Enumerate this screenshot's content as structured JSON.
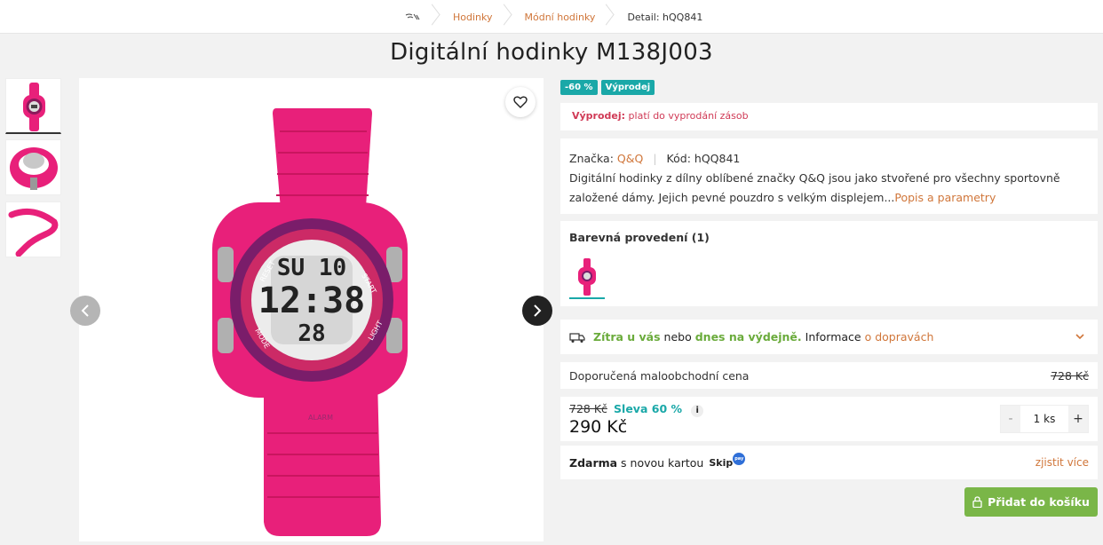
{
  "breadcrumb": {
    "items": [
      "Hodinky",
      "Módní hodinky",
      "Detail: hQQ841"
    ]
  },
  "product": {
    "title": "Digitální hodinky M138J003",
    "badges": [
      "-60 %",
      "Výprodej"
    ],
    "sale_label": "Výprodej:",
    "sale_text": "platí do vyprodání zásob",
    "brand_label": "Značka:",
    "brand": "Q&Q",
    "code_label": "Kód:",
    "code": "hQQ841",
    "description": "Digitální hodinky z dílny oblíbené značky Q&Q jsou jako stvořené pro všechny sportovně založené dámy. Jejich pevné pouzdro s velkým displejem...",
    "description_link": "Popis a parametry",
    "variants_title": "Barevná provedení (1)"
  },
  "delivery": {
    "part1": "Zítra u vás",
    "part2": " nebo ",
    "part3": "dnes na výdejně.",
    "part4": " Informace ",
    "link": "o dopravách"
  },
  "pricing": {
    "rrp_label": "Doporučená maloobchodní cena",
    "rrp_value": "728 Kč",
    "old_price": "728 Kč",
    "discount": "Sleva 60 %",
    "info_icon": "i",
    "price": "290 Kč",
    "qty_minus": "-",
    "qty_value": "1 ks",
    "qty_plus": "+"
  },
  "promo": {
    "bold": "Zdarma",
    "text": " s novou kartou",
    "brand": "Skip",
    "brand_badge": "pay",
    "link": "zjistit více"
  },
  "add_to_cart": "Přidat do košíku",
  "colors": {
    "accent_orange": "#d0763a",
    "teal": "#1aa8a8",
    "sale_red": "#d03a56",
    "green": "#7ab648",
    "watch_pink": "#e8207a"
  }
}
